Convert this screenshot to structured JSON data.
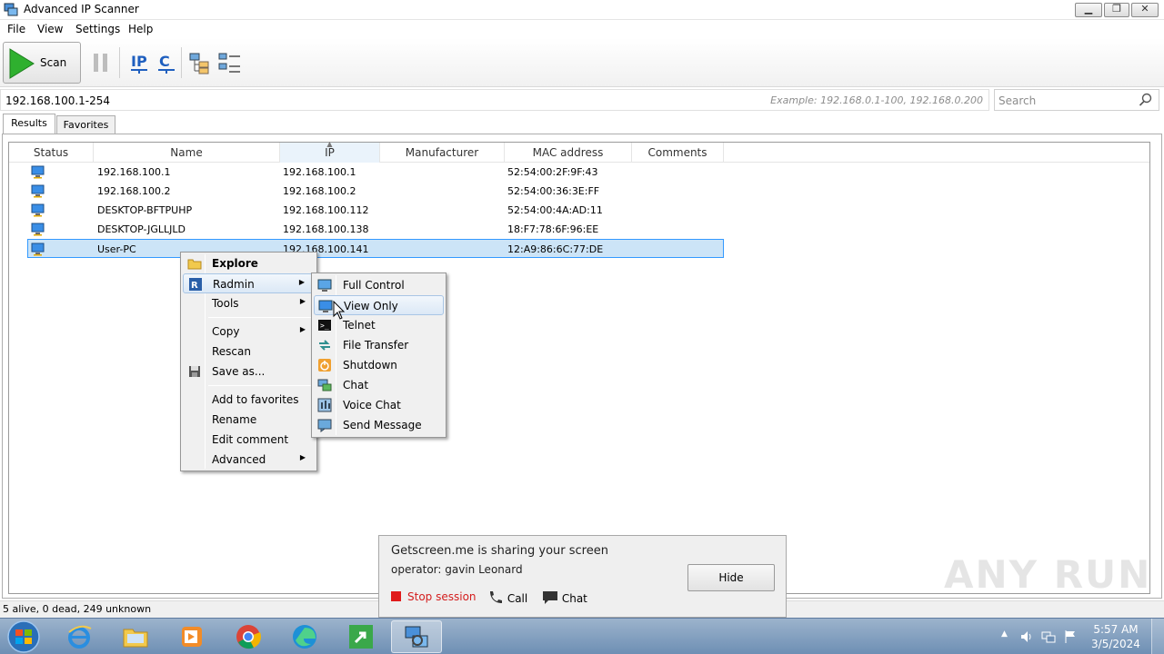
{
  "window": {
    "title": "Advanced IP Scanner"
  },
  "menu": [
    "File",
    "View",
    "Settings",
    "Help"
  ],
  "toolbar": {
    "scan_label": "Scan",
    "accent_green": "#2fb02f",
    "icons": [
      "play-icon",
      "pause-icon",
      "ip-icon",
      "c-icon",
      "tree-view-icon",
      "list-view-icon"
    ]
  },
  "address": {
    "value": "192.168.100.1-254",
    "hint": "Example: 192.168.0.1-100, 192.168.0.200"
  },
  "search": {
    "placeholder": "Search"
  },
  "tabs": [
    "Results",
    "Favorites"
  ],
  "table": {
    "columns": [
      "Status",
      "Name",
      "IP",
      "Manufacturer",
      "MAC address",
      "Comments"
    ],
    "rows": [
      {
        "name": "192.168.100.1",
        "ip": "192.168.100.1",
        "mac": "52:54:00:2F:9F:43"
      },
      {
        "name": "192.168.100.2",
        "ip": "192.168.100.2",
        "mac": "52:54:00:36:3E:FF"
      },
      {
        "name": "DESKTOP-BFTPUHP",
        "ip": "192.168.100.112",
        "mac": "52:54:00:4A:AD:11"
      },
      {
        "name": "DESKTOP-JGLLJLD",
        "ip": "192.168.100.138",
        "mac": "18:F7:78:6F:96:EE"
      },
      {
        "name": "User-PC",
        "ip": "192.168.100.141",
        "mac": "12:A9:86:6C:77:DE"
      }
    ]
  },
  "context_menu": {
    "items": [
      "Explore",
      "Radmin",
      "Tools",
      "Copy",
      "Rescan",
      "Save as...",
      "Add to favorites",
      "Rename",
      "Edit comment",
      "Advanced"
    ]
  },
  "radmin_submenu": {
    "items": [
      "Full Control",
      "View Only",
      "Telnet",
      "File Transfer",
      "Shutdown",
      "Chat",
      "Voice Chat",
      "Send Message"
    ]
  },
  "getscreen": {
    "line1": "Getscreen.me is sharing your screen",
    "line2": "operator: gavin Leonard",
    "hide": "Hide",
    "stop": "Stop session",
    "call": "Call",
    "chat": "Chat"
  },
  "status": {
    "text": "5 alive, 0 dead, 249 unknown"
  },
  "watermark": "ANY RUN",
  "clock": {
    "time": "5:57 AM",
    "date": "3/5/2024"
  }
}
